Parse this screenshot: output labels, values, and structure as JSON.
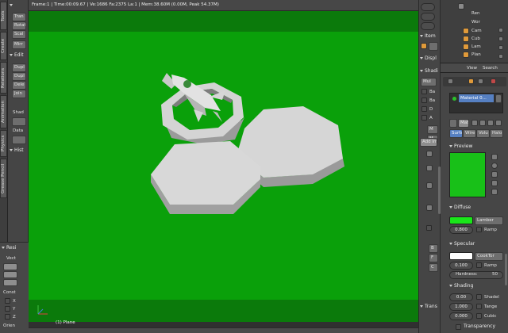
{
  "viewport": {
    "stats": "Frame:1 | Time:00:09.67 | Ve:1686 Fa:2375 La:1 | Mem:38.60M (0.00M, Peak 54.37M)",
    "object_name": "(1) Plane",
    "bg_color": "#0aa00a"
  },
  "toolshelf": {
    "vtabs": [
      "Tools",
      "Create",
      "Relations",
      "Animation",
      "Physics",
      "Grease Pencil"
    ],
    "transform_buttons": [
      "Tran",
      "Rotat",
      "Scal",
      "Mirr"
    ],
    "edit_header": "Edit",
    "edit_buttons": [
      "Dupl",
      "Dupl",
      "Dele",
      "Join"
    ],
    "shade_label": "Shad",
    "data_label": "Data",
    "history_header": "Hist",
    "reset_header": "Resi",
    "vect_label": "Vect",
    "const_label": "Const",
    "axes": [
      "X",
      "Y",
      "Z"
    ],
    "orien_label": "Orien"
  },
  "middle": {
    "item_header": "Item",
    "display_header": "Displ",
    "shading_header": "Shadi",
    "mul_value": "Mul",
    "checks": [
      "Ba",
      "Ba",
      "D",
      "A"
    ],
    "add_label": "Add Im",
    "transform_header": "Trans",
    "labels": [
      "M",
      "M",
      "B",
      "F",
      "C"
    ]
  },
  "outliner": {
    "items": [
      "Ren",
      "Wor",
      "Cam",
      "Cub",
      "Lam",
      "Plan"
    ],
    "menu": [
      "View",
      "Search"
    ]
  },
  "properties": {
    "material_slot": "Material 0...",
    "mat_field": "Mat",
    "shading_tabs": [
      "Surfa",
      "Wire",
      "Volu",
      "Halo"
    ],
    "preview_header": "Preview",
    "preview_color": "#18c018",
    "diffuse_header": "Diffuse",
    "diffuse_color": "#19e619",
    "diffuse_shader": "Lamber",
    "diffuse_intensity": "0.800",
    "ramp_label": "Ramp",
    "specular_header": "Specular",
    "specular_shader": "CookTor",
    "specular_intensity": "0.100",
    "hardness": "Hardness:",
    "hardness_value": "50",
    "shading_header": "Shading",
    "emit": "0.00",
    "ambient": "1.000",
    "translucency": "0.000",
    "shadeless_label": "Shadel",
    "tangent_label": "Tange",
    "cubic_label": "Cubic",
    "transparency_header": "Transparency"
  }
}
